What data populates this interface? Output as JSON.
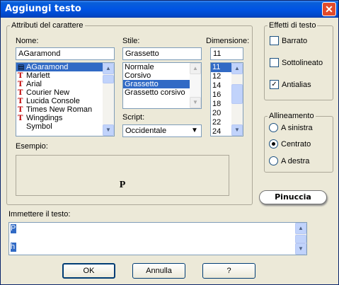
{
  "window": {
    "title": "Aggiungi testo",
    "close_glyph": "✕"
  },
  "attributes": {
    "legend": "Attributi del carattere",
    "nome_label": "Nome:",
    "nome_value": "AGaramond",
    "fonts": [
      {
        "label": "AGaramond",
        "icon": "printer-font-icon",
        "selected": true
      },
      {
        "label": "Marlett",
        "icon": "truetype-icon"
      },
      {
        "label": "Arial",
        "icon": "truetype-icon"
      },
      {
        "label": "Courier New",
        "icon": "truetype-icon"
      },
      {
        "label": "Lucida Console",
        "icon": "truetype-icon"
      },
      {
        "label": "Times New Roman",
        "icon": "truetype-icon"
      },
      {
        "label": "Wingdings",
        "icon": "truetype-icon"
      },
      {
        "label": "Symbol",
        "icon": "none"
      }
    ],
    "stile_label": "Stile:",
    "stile_value": "Grassetto",
    "styles": [
      {
        "label": "Normale"
      },
      {
        "label": "Corsivo"
      },
      {
        "label": "Grassetto",
        "selected": true
      },
      {
        "label": "Grassetto corsivo"
      }
    ],
    "dimensione_label": "Dimensione:",
    "dimensione_value": "11",
    "sizes": [
      {
        "label": "11",
        "selected": true
      },
      {
        "label": "12"
      },
      {
        "label": "14"
      },
      {
        "label": "16"
      },
      {
        "label": "18"
      },
      {
        "label": "20"
      },
      {
        "label": "22"
      },
      {
        "label": "24"
      }
    ],
    "script_label": "Script:",
    "script_value": "Occidentale",
    "esempio_label": "Esempio:",
    "sample_text": "P"
  },
  "effects": {
    "legend": "Effetti di testo",
    "items": [
      {
        "label": "Barrato",
        "checked": false
      },
      {
        "label": "Sottolineato",
        "checked": false
      },
      {
        "label": "Antialias",
        "checked": true
      }
    ],
    "check_glyph": "✓"
  },
  "alignment": {
    "legend": "Allineamento",
    "items": [
      {
        "label": "A sinistra",
        "selected": false
      },
      {
        "label": "Centrato",
        "selected": true
      },
      {
        "label": "A destra",
        "selected": false
      }
    ]
  },
  "logo_text": "Pinuccia",
  "text_input": {
    "label": "Immettere il testo:",
    "lines": [
      "P",
      "",
      "h"
    ]
  },
  "buttons": {
    "ok": "OK",
    "annulla": "Annulla",
    "help": "?"
  },
  "glyphs": {
    "up": "▲",
    "down": "▼",
    "tt": "T",
    "printer": "▤"
  },
  "colors": {
    "selection": "#316ac5",
    "titlebar": "#0054e3",
    "close": "#e24a2b"
  }
}
